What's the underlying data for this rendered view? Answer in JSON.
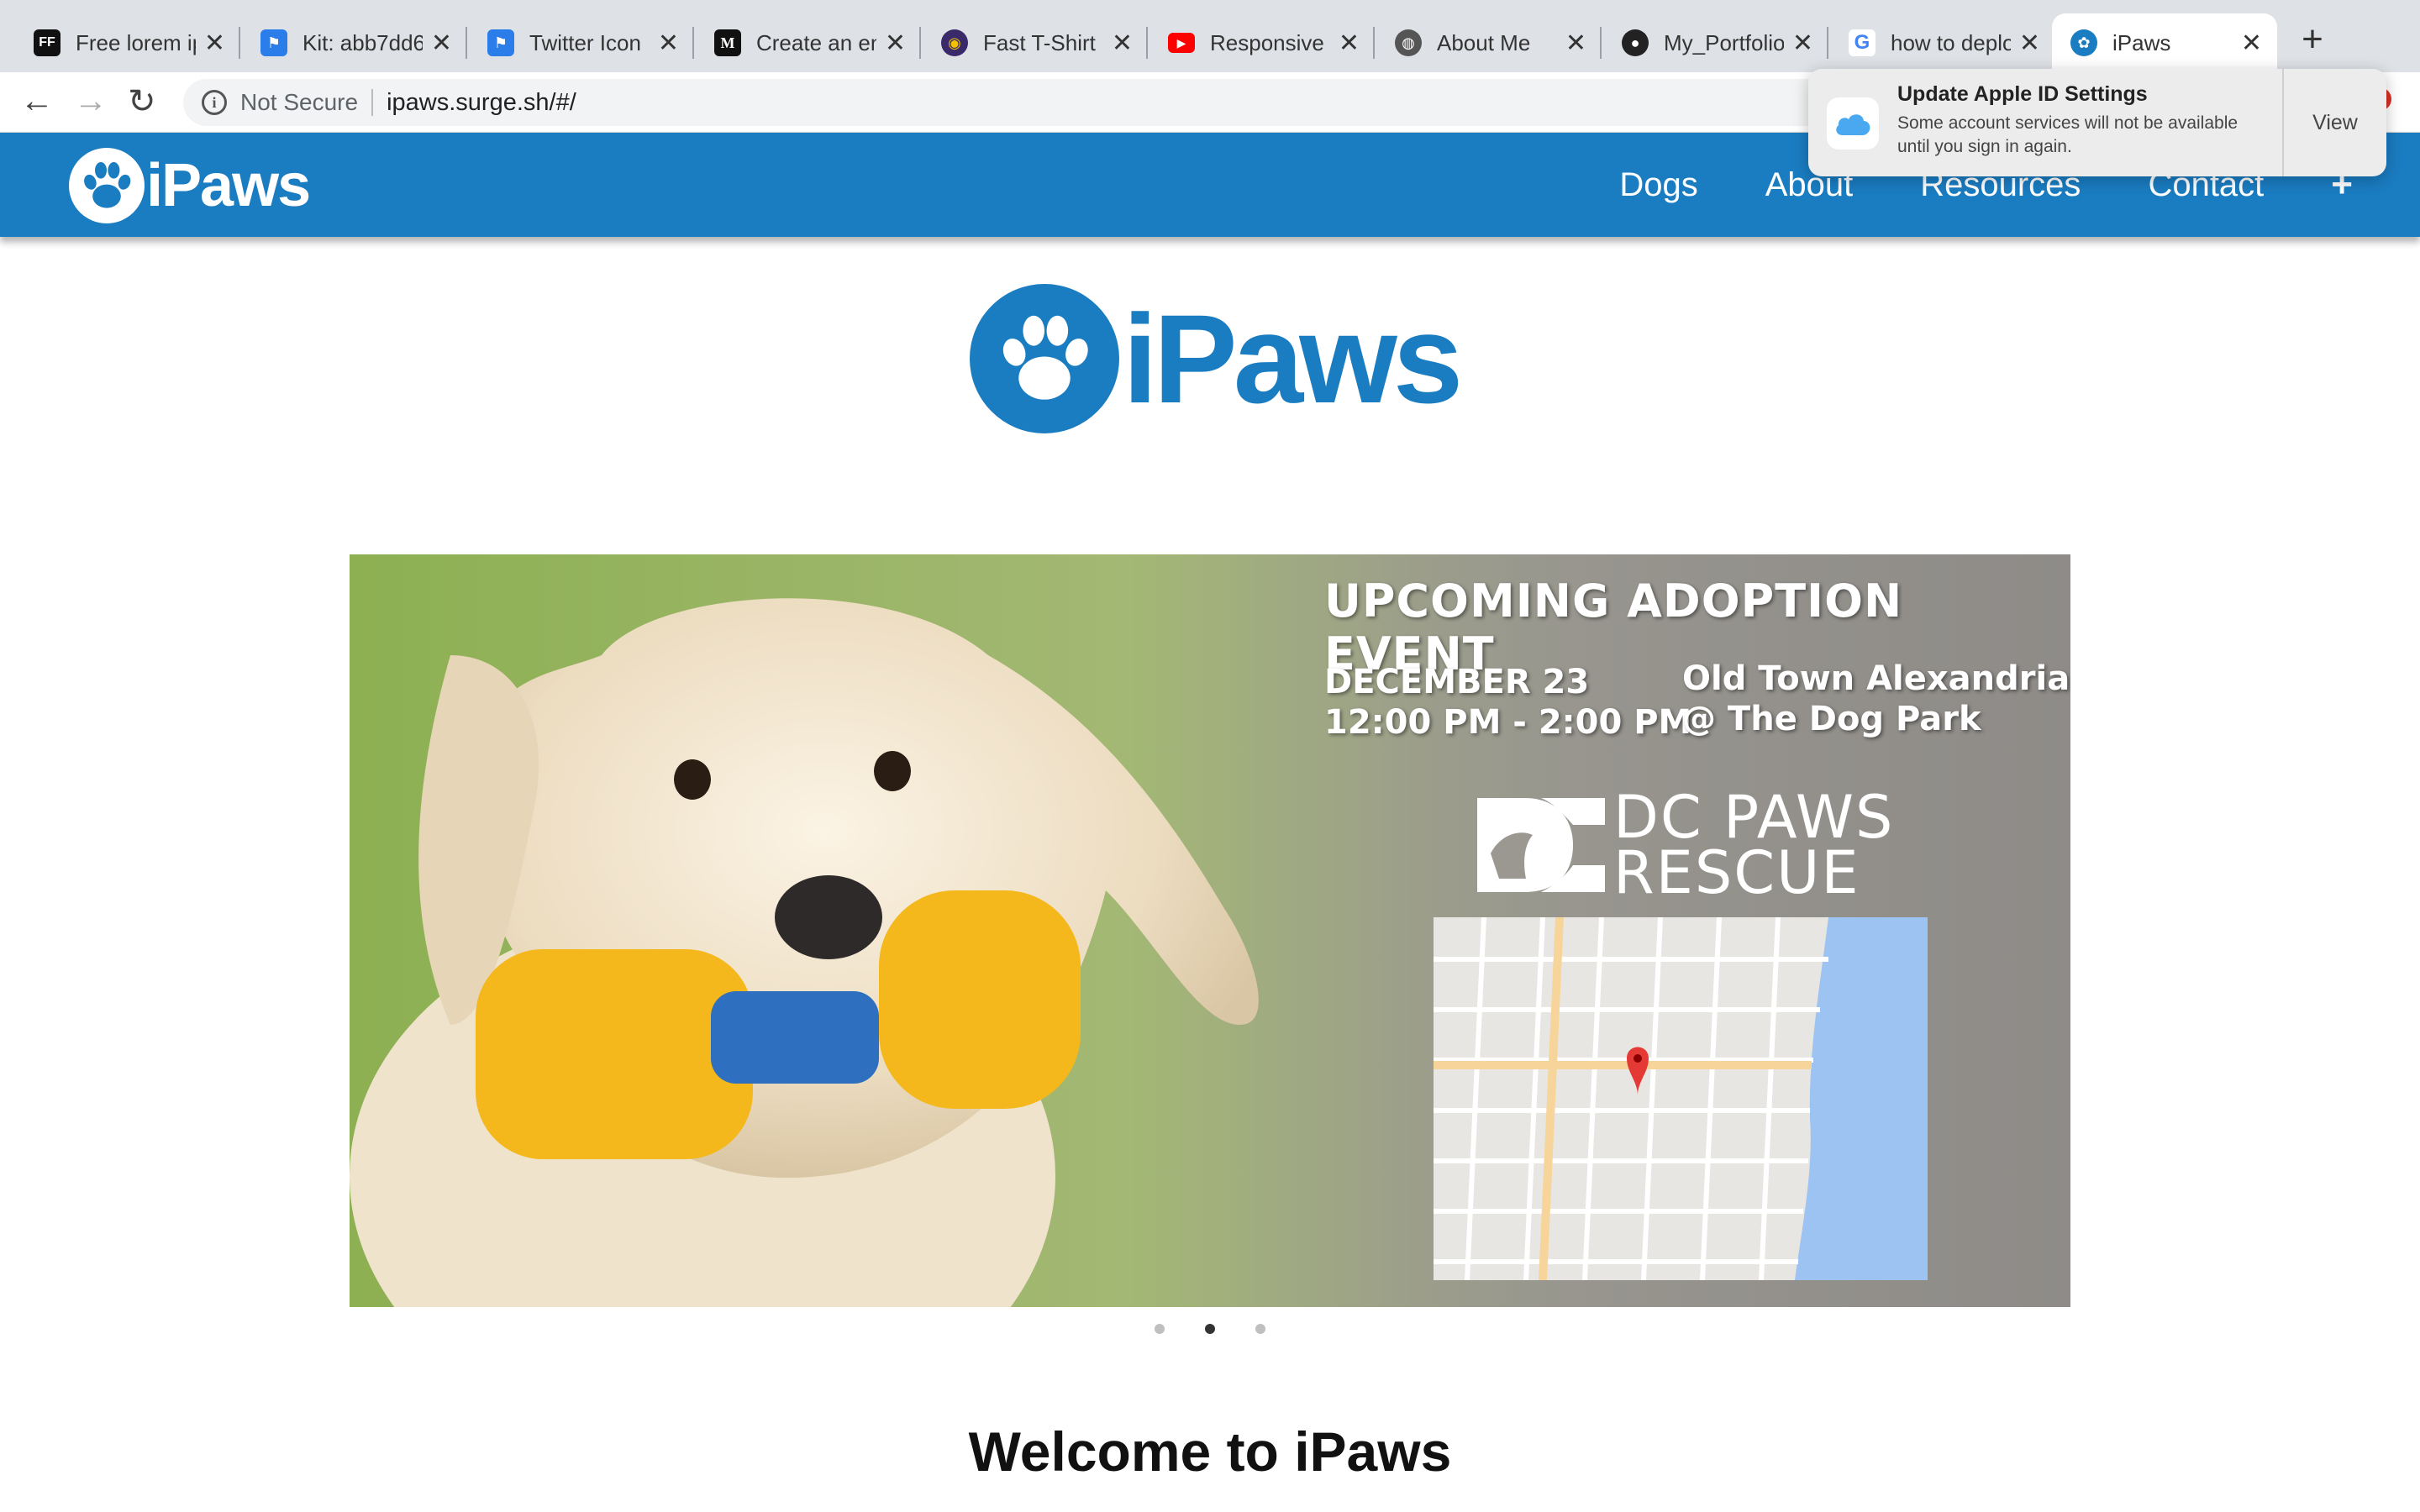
{
  "browser": {
    "tabs": [
      {
        "title": "Free lorem ipsum",
        "favicon": "ff-icon",
        "color": "#111111",
        "glyph": "FF"
      },
      {
        "title": "Kit: abb7dd6",
        "favicon": "flag-icon",
        "color": "#2b7de9",
        "glyph": "⚑"
      },
      {
        "title": "Twitter Icon",
        "favicon": "flag-icon",
        "color": "#2b7de9",
        "glyph": "⚑"
      },
      {
        "title": "Create an en",
        "favicon": "medium-icon",
        "color": "#111111",
        "glyph": "M"
      },
      {
        "title": "Fast T-Shirt",
        "favicon": "shirt-icon",
        "color": "#3a2a6a",
        "glyph": "◉"
      },
      {
        "title": "Responsive",
        "favicon": "youtube-icon",
        "color": "#ff0000",
        "glyph": "▶"
      },
      {
        "title": "About Me",
        "favicon": "globe-icon",
        "color": "#555555",
        "glyph": "◍"
      },
      {
        "title": "My_Portfolio",
        "favicon": "github-icon",
        "color": "#222222",
        "glyph": "●"
      },
      {
        "title": "how to deplo",
        "favicon": "google-icon",
        "color": "#ffffff",
        "glyph": "G"
      },
      {
        "title": "iPaws",
        "favicon": "paw-icon",
        "color": "#1a7cc1",
        "glyph": "✿",
        "active": true
      }
    ],
    "security_label": "Not Secure",
    "url": "ipaws.surge.sh/#/"
  },
  "notification": {
    "title": "Update Apple ID Settings",
    "message": "Some account services will not be available until you sign in again.",
    "action": "View"
  },
  "site": {
    "brand": "iPaws",
    "nav": [
      "Dogs",
      "About",
      "Resources",
      "Contact"
    ],
    "nav_plus": "+",
    "hero_brand": "iPaws",
    "carousel": {
      "headline": "UPCOMING ADOPTION EVENT",
      "date_line1": "DECEMBER 23",
      "date_line2": "12:00 PM - 2:00 PM",
      "loc_line1": "Old Town Alexandria",
      "loc_line2": "@ The Dog Park",
      "org_line1": "DC PAWS",
      "org_line2": "RESCUE",
      "active_slide": 2,
      "slide_count": 3
    },
    "welcome": "Welcome to iPaws"
  },
  "colors": {
    "brand_blue": "#1a7cc1",
    "tab_strip": "#dee1e6"
  }
}
